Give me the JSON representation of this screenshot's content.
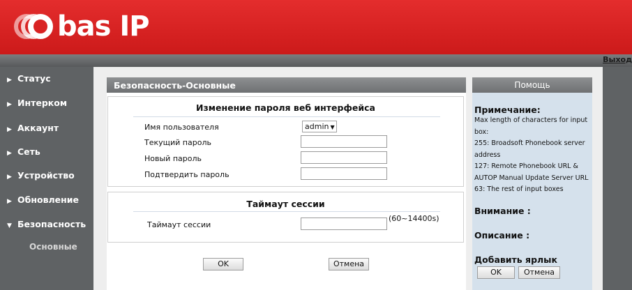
{
  "brand": {
    "logo_text": "bas IP"
  },
  "topbar": {
    "logout": "Выход"
  },
  "sidebar": {
    "items": [
      {
        "label": "Статус",
        "expanded": false
      },
      {
        "label": "Интерком",
        "expanded": false
      },
      {
        "label": "Аккаунт",
        "expanded": false
      },
      {
        "label": "Сеть",
        "expanded": false
      },
      {
        "label": "Устройство",
        "expanded": false
      },
      {
        "label": "Обновление",
        "expanded": false
      },
      {
        "label": "Безопасность",
        "expanded": true
      }
    ],
    "subitem": "Основные"
  },
  "panel": {
    "title": "Безопасность-Основные",
    "password_section": {
      "title": "Изменение пароля веб интерфейса",
      "username_label": "Имя пользователя",
      "username_value": "admin",
      "current_label": "Текущий пароль",
      "new_label": "Новый пароль",
      "confirm_label": "Подтвердить пароль"
    },
    "session_section": {
      "title": "Таймаут сессии",
      "label": "Таймаут сессии",
      "value": "",
      "range": "(60~14400s)"
    },
    "ok_label": "OK",
    "cancel_label": "Отмена"
  },
  "help": {
    "title": "Помощь",
    "note_heading": "Примечание:",
    "note_lines": [
      "Max length of characters for input",
      "box:",
      "255: Broadsoft Phonebook server",
      "address",
      "127: Remote Phonebook URL &",
      "AUTOP Manual Update Server URL",
      "63: The rest of input boxes"
    ],
    "attention": "Внимание :",
    "description": "Описание :",
    "add_shortcut": "Добавить ярлык",
    "ok_label": "OK",
    "cancel_label": "Отмена"
  },
  "colors": {
    "brand_red": "#d92323",
    "sidebar_bg": "#5f6264",
    "help_bg": "#d5e1ec"
  }
}
